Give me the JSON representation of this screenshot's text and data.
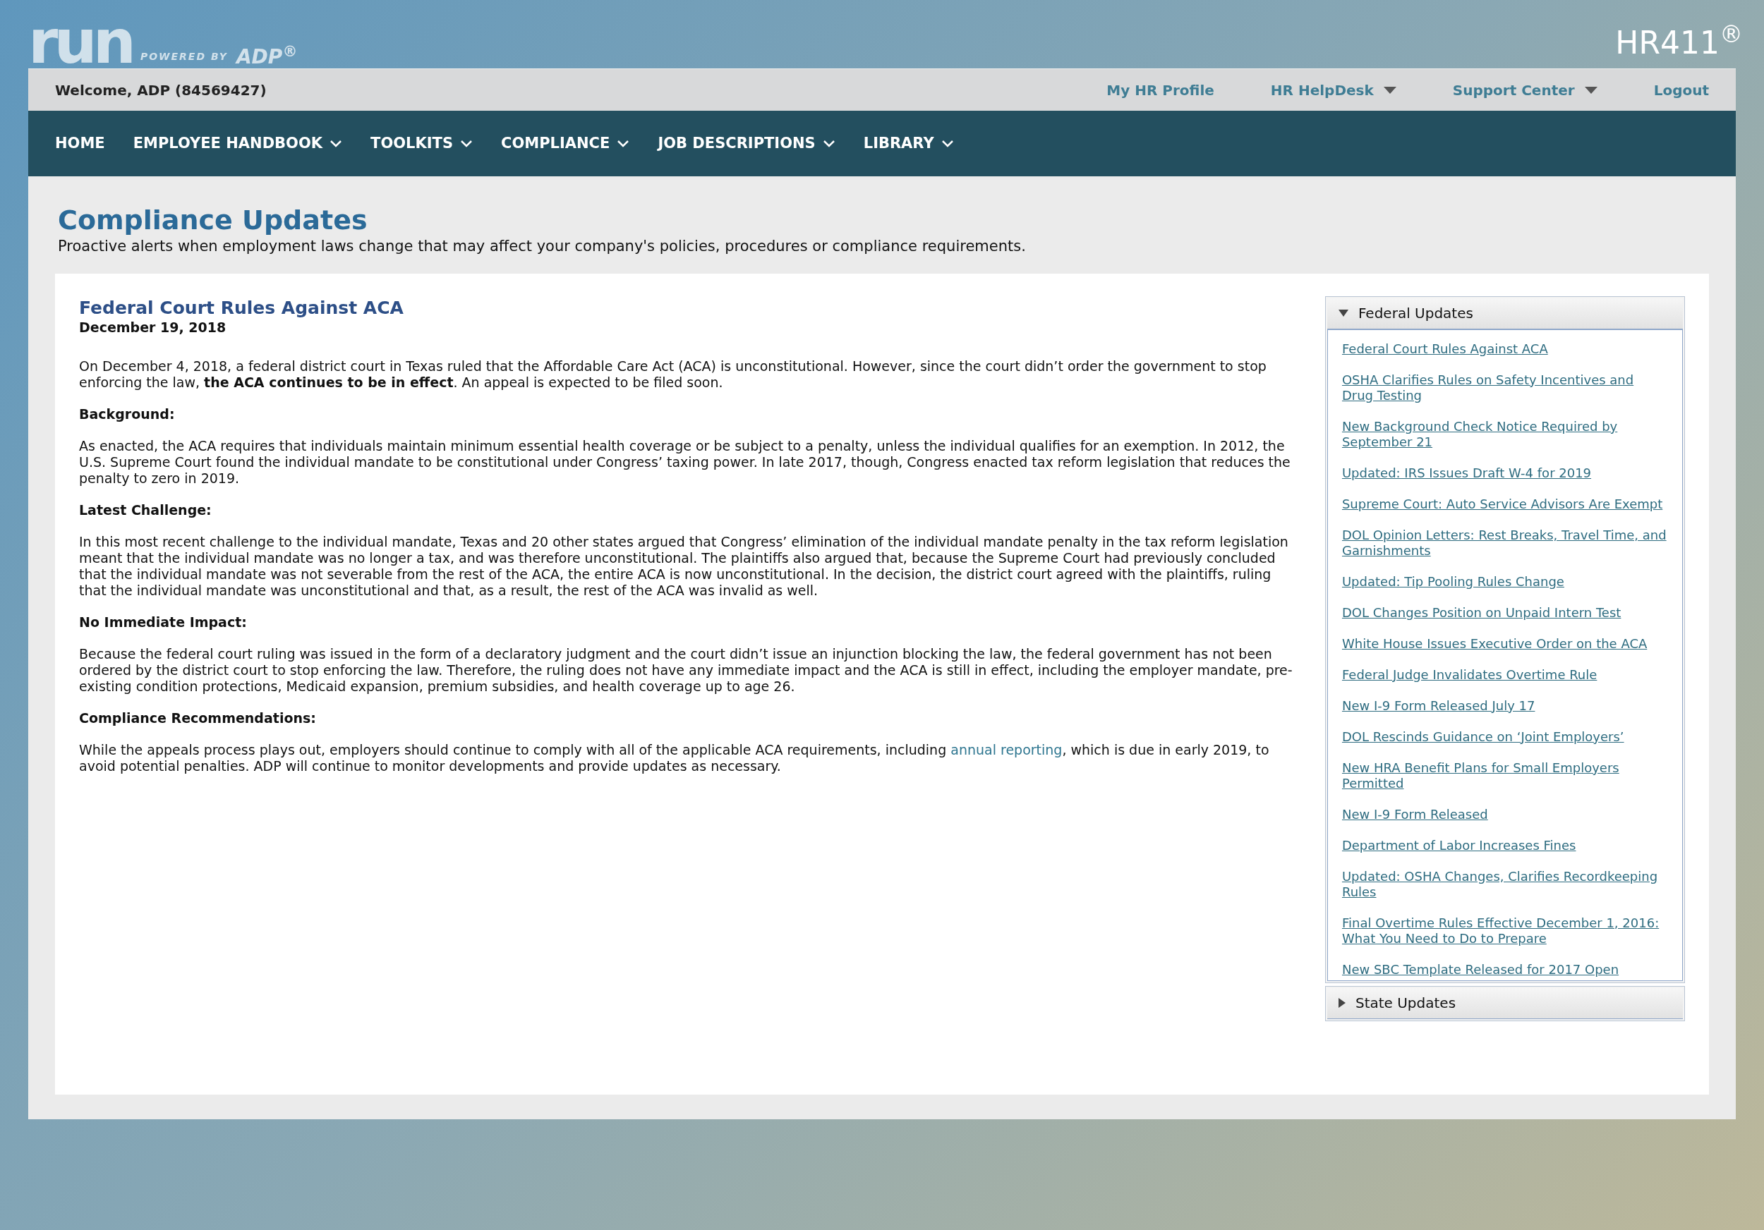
{
  "brand": {
    "logo": "run",
    "powered_by": "POWERED BY",
    "partner": "ADP",
    "partner_mark": "®",
    "product": "HR411",
    "product_mark": "®"
  },
  "top_bar": {
    "welcome": "Welcome, ADP (84569427)",
    "links": [
      {
        "label": "My HR Profile",
        "dropdown": false
      },
      {
        "label": "HR HelpDesk",
        "dropdown": true
      },
      {
        "label": "Support Center",
        "dropdown": true
      },
      {
        "label": "Logout",
        "dropdown": false
      }
    ]
  },
  "nav": [
    {
      "label": "HOME",
      "dropdown": false
    },
    {
      "label": "EMPLOYEE HANDBOOK",
      "dropdown": true
    },
    {
      "label": "TOOLKITS",
      "dropdown": true
    },
    {
      "label": "COMPLIANCE",
      "dropdown": true
    },
    {
      "label": "JOB DESCRIPTIONS",
      "dropdown": true
    },
    {
      "label": "LIBRARY",
      "dropdown": true
    }
  ],
  "page": {
    "title": "Compliance Updates",
    "subtitle": "Proactive alerts when employment laws change that may affect your company's policies, procedures or compliance requirements."
  },
  "article": {
    "title": "Federal Court Rules Against ACA",
    "date": "December 19, 2018",
    "blocks": [
      {
        "kind": "paragraph",
        "text": "On December 4, 2018, a federal district court in Texas ruled that the Affordable Care Act (ACA) is unconstitutional. However, since the court didn’t order the government to stop enforcing the law, **the ACA continues to be in effect**. An appeal is expected to be filed soon."
      },
      {
        "kind": "heading",
        "text": "Background:"
      },
      {
        "kind": "paragraph",
        "text": "As enacted, the ACA requires that individuals maintain minimum essential health coverage or be subject to a penalty, unless the individual qualifies for an exemption. In 2012, the U.S. Supreme Court found the individual mandate to be constitutional under Congress’ taxing power. In late 2017, though, Congress enacted tax reform legislation that reduces the penalty to zero in 2019."
      },
      {
        "kind": "heading",
        "text": "Latest Challenge:"
      },
      {
        "kind": "paragraph",
        "text": "In this most recent challenge to the individual mandate, Texas and 20 other states argued that Congress’ elimination of the individual mandate penalty in the tax reform legislation meant that the individual mandate was no longer a tax, and was therefore unconstitutional. The plaintiffs also argued that, because the Supreme Court had previously concluded that the individual mandate was not severable from the rest of the ACA, the entire ACA is now unconstitutional. In the decision, the district court agreed with the plaintiffs, ruling that the individual mandate was unconstitutional and that, as a result, the rest of the ACA was invalid as well."
      },
      {
        "kind": "heading",
        "text": "No Immediate Impact:"
      },
      {
        "kind": "paragraph",
        "text": "Because the federal court ruling was issued in the form of a declaratory judgment and the court didn’t issue an injunction blocking the law, the federal government has not been ordered by the district court to stop enforcing the law. Therefore, the ruling does not have any immediate impact and the ACA is still in effect, including the employer mandate, pre-existing condition protections, Medicaid expansion, premium subsidies, and health coverage up to age 26."
      },
      {
        "kind": "heading",
        "text": "Compliance Recommendations:"
      },
      {
        "kind": "linked_paragraph",
        "before": "While the appeals process plays out, employers should continue to comply with all of the applicable ACA requirements, including",
        "link": "annual reporting",
        "after": ", which is due in early 2019, to avoid potential penalties. ADP will continue to monitor developments and provide updates as necessary."
      }
    ]
  },
  "sidebar": {
    "sections": [
      {
        "title": "Federal Updates",
        "expanded": true,
        "items": [
          "Federal Court Rules Against ACA",
          "OSHA Clarifies Rules on Safety Incentives and Drug Testing",
          "New Background Check Notice Required by September 21",
          "Updated: IRS Issues Draft W-4 for 2019",
          "Supreme Court: Auto Service Advisors Are Exempt",
          "DOL Opinion Letters: Rest Breaks, Travel Time, and Garnishments",
          "Updated: Tip Pooling Rules Change",
          "DOL Changes Position on Unpaid Intern Test",
          "White House Issues Executive Order on the ACA",
          "Federal Judge Invalidates Overtime Rule",
          "New I-9 Form Released July 17",
          "DOL Rescinds Guidance on ‘Joint Employers’",
          "New HRA Benefit Plans for Small Employers Permitted",
          "New I-9 Form Released",
          "Department of Labor Increases Fines",
          "Updated: OSHA Changes, Clarifies Recordkeeping Rules",
          "Final Overtime Rules Effective December 1, 2016: What You Need to Do to Prepare",
          "New SBC Template Released for 2017 Open"
        ]
      },
      {
        "title": "State Updates",
        "expanded": false
      }
    ]
  }
}
